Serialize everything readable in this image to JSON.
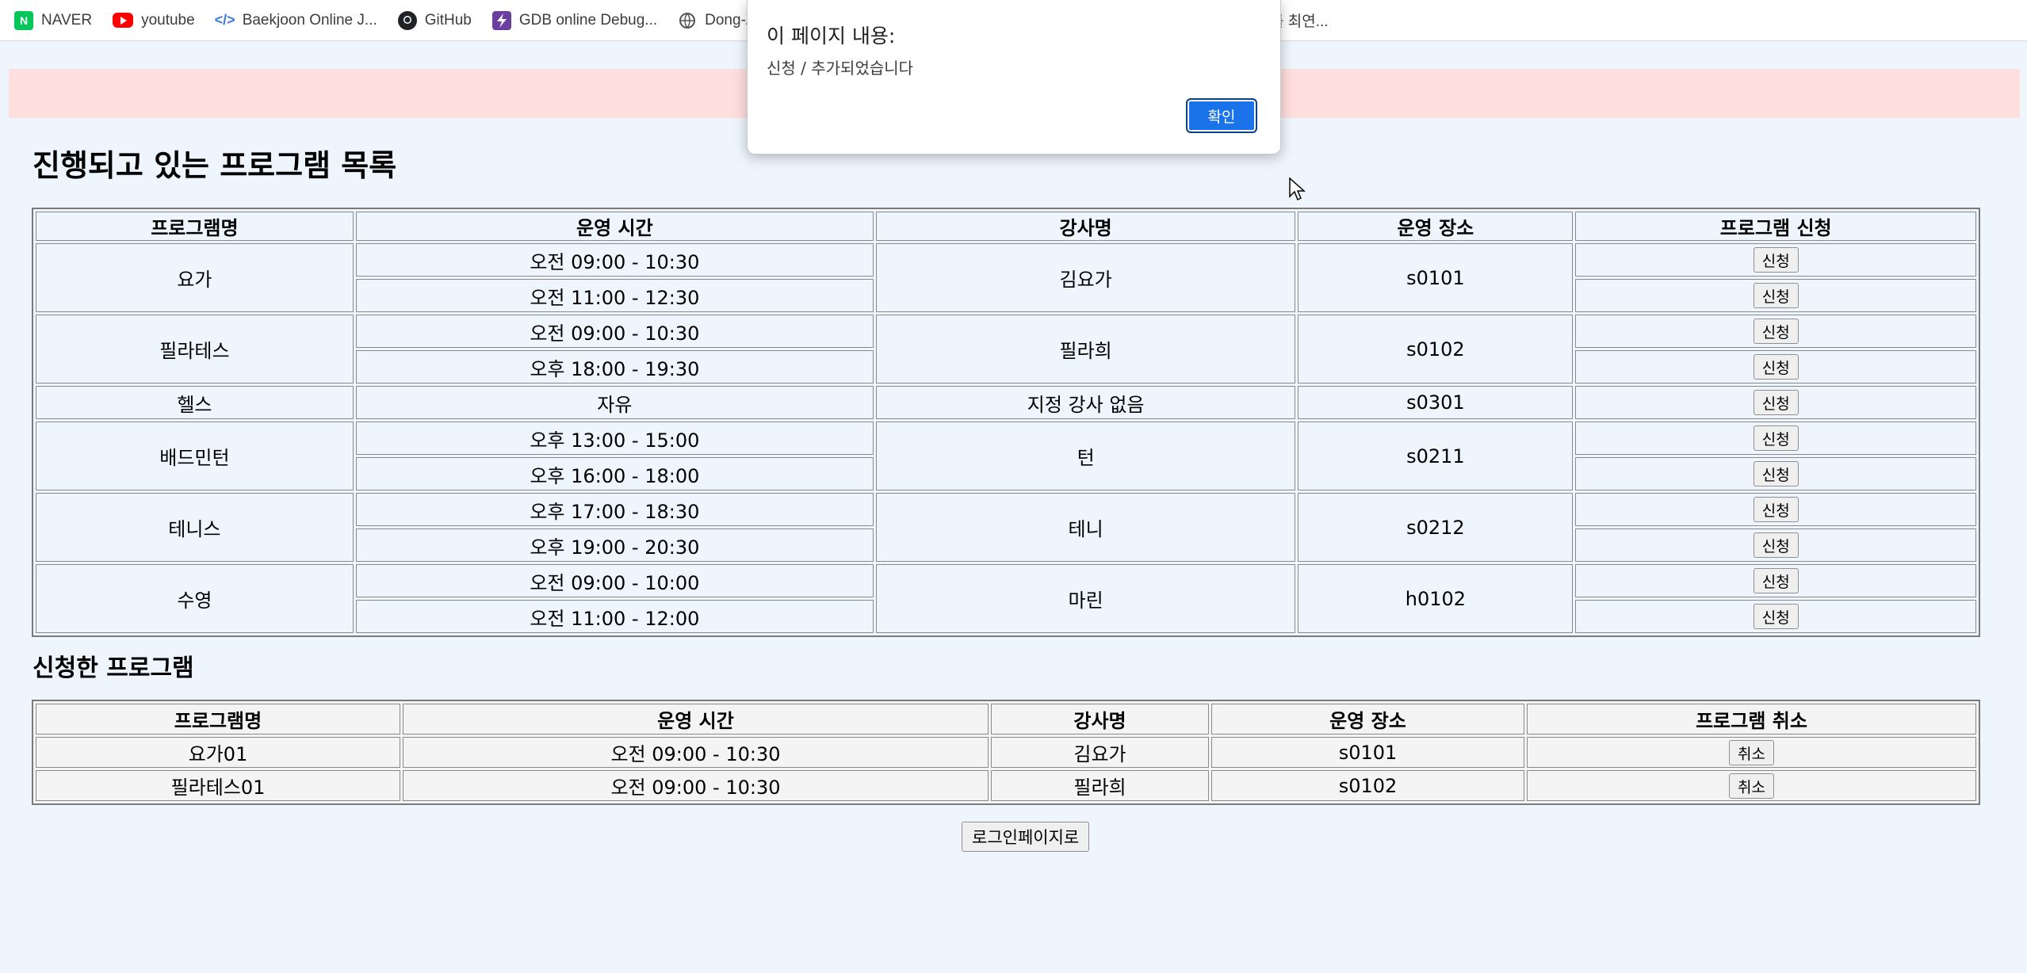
{
  "bookmarks": [
    {
      "label": "NAVER",
      "icon": "naver-icon"
    },
    {
      "label": "youtube",
      "icon": "youtube-icon"
    },
    {
      "label": "Baekjoon Online J...",
      "icon": "code-icon"
    },
    {
      "label": "GitHub",
      "icon": "github-icon"
    },
    {
      "label": "GDB online Debug...",
      "icon": "lightning-icon"
    },
    {
      "label": "Dong-A",
      "icon": "globe-icon"
    }
  ],
  "bookmark_right": "를 최연...",
  "dialog": {
    "title": "이 페이지 내용:",
    "message": "신청 / 추가되었습니다",
    "ok_label": "확인"
  },
  "page": {
    "title": "진행되고 있는 프로그램 목록",
    "applied_title": "신청한 프로그램",
    "login_button": "로그인페이지로"
  },
  "programs": {
    "headers": [
      "프로그램명",
      "운영 시간",
      "강사명",
      "운영 장소",
      "프로그램 신청"
    ],
    "apply_label": "신청",
    "groups": [
      {
        "name": "요가",
        "instructor": "김요가",
        "place": "s0101",
        "times": [
          "오전 09:00 - 10:30",
          "오전 11:00 - 12:30"
        ]
      },
      {
        "name": "필라테스",
        "instructor": "필라희",
        "place": "s0102",
        "times": [
          "오전 09:00 - 10:30",
          "오후 18:00 - 19:30"
        ]
      },
      {
        "name": "헬스",
        "instructor": "지정 강사 없음",
        "place": "s0301",
        "times": [
          "자유"
        ]
      },
      {
        "name": "배드민턴",
        "instructor": "턴",
        "place": "s0211",
        "times": [
          "오후 13:00 - 15:00",
          "오후 16:00 - 18:00"
        ]
      },
      {
        "name": "테니스",
        "instructor": "테니",
        "place": "s0212",
        "times": [
          "오후 17:00 - 18:30",
          "오후 19:00 - 20:30"
        ]
      },
      {
        "name": "수영",
        "instructor": "마린",
        "place": "h0102",
        "times": [
          "오전 09:00 - 10:00",
          "오전 11:00 - 12:00"
        ]
      }
    ]
  },
  "applied": {
    "headers": [
      "프로그램명",
      "운영 시간",
      "강사명",
      "운영 장소",
      "프로그램 취소"
    ],
    "cancel_label": "취소",
    "rows": [
      {
        "name": "요가01",
        "time": "오전 09:00 - 10:30",
        "instructor": "김요가",
        "place": "s0101"
      },
      {
        "name": "필라테스01",
        "time": "오전 09:00 - 10:30",
        "instructor": "필라희",
        "place": "s0102"
      }
    ]
  }
}
